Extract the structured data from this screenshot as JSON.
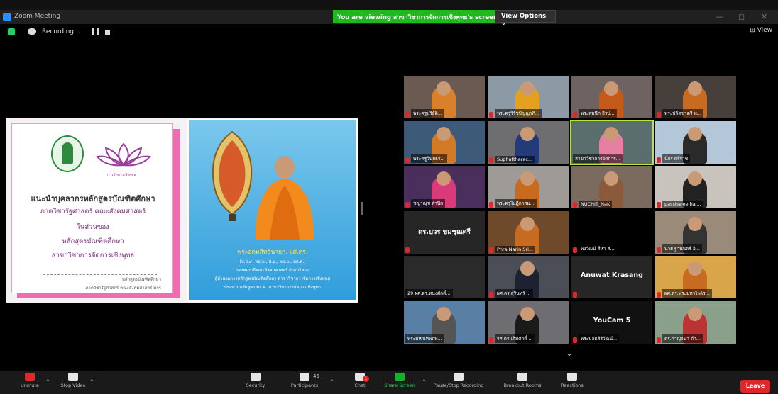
{
  "window": {
    "title": "Zoom Meeting",
    "minimize": "—",
    "maximize": "◻",
    "close": "✕"
  },
  "share_banner": {
    "text": "You are viewing สาขาวิชาการจัดการเชิงพุทธ's screen",
    "view_options": "View Options ⌄"
  },
  "recording": {
    "label": "Recording...",
    "pause": "❚❚"
  },
  "view_button": "⊞ View",
  "shared_slide": {
    "logo_caption": "การจัดการเชิงพุทธ",
    "lines": [
      "แนะนำบุคลากรหลักสูตรบัณฑิตศึกษา",
      "ภาควิชารัฐศาสตร์ คณะสังคมศาสตร์",
      "ในส่วนของ",
      "หลักสูตรบัณฑิตศึกษา",
      "สาขาวิชาการจัดการเชิงพุทธ"
    ],
    "footer": [
      "หลักสูตรบัณฑิตศึกษา",
      "ภาควิชารัฐศาสตร์ คณะสังคมศาสตร์ มจร"
    ],
    "monk_name": "พระอุดมสิทธินายก, ผศ.ดร.",
    "monk_lines": [
      "(ป.ธ.๙, พธ.บ., ป.ม., พธ.ม., พธ.ด.)",
      "รองคณบดีคณะสังคมศาสตร์ ฝ่ายบริหาร",
      "ผู้อำนวยการหลักสูตรบัณฑิตศึกษา สาขาวิชาการจัดการเชิงพุทธ",
      "ประธานหลักสูตร พธ.ด. สาขาวิชาการจัดการเชิงพุทธ"
    ]
  },
  "participants_grid": [
    {
      "name": "พระครูปริยัติ...",
      "bg": "#6a5a52",
      "shirt": "#d9802a",
      "head": "#c99a75",
      "muted": true
    },
    {
      "name": "พระครูวิรัชปัญญาภิ...",
      "bg": "#8b9aa5",
      "shirt": "#e5a020",
      "head": "#c99a75",
      "muted": true
    },
    {
      "name": "พระสมนึก ธีรป...",
      "bg": "#6e6360",
      "shirt": "#c45a1a",
      "head": "#c99a75",
      "muted": true
    },
    {
      "name": "พระปลัดชาตรี พ...",
      "bg": "#473f3c",
      "shirt": "#c86a20",
      "head": "#c99a75",
      "muted": true
    },
    {
      "name": "พระครูวินัยธร...",
      "bg": "#3d5a78",
      "shirt": "#d37a26",
      "head": "#c99a75",
      "muted": true
    },
    {
      "name": "Suphattharac...",
      "bg": "#6e6e70",
      "shirt": "#243b7a",
      "head": "#c99a75",
      "muted": true
    },
    {
      "name": "สาขาวิชาการจัดการ...",
      "bg": "#5b6e6e",
      "shirt": "#e67fa0",
      "head": "#c99a75",
      "muted": false
    },
    {
      "name": "นิกร ศรีราช",
      "bg": "#b3c7d9",
      "shirt": "#2a2a2a",
      "head": "#c99a75",
      "muted": true
    },
    {
      "name": "ชญาณุช สำนึก",
      "bg": "#4a2f5c",
      "shirt": "#d93a7a",
      "head": "#c99a75",
      "muted": true
    },
    {
      "name": "พระครูใบฎีกาสม...",
      "bg": "#9e9a95",
      "shirt": "#c86a20",
      "head": "#c99a75",
      "muted": true
    },
    {
      "name": "NUCHIT_NaK",
      "bg": "#7a6b5e",
      "shirt": "#8a5a3a",
      "head": "#c99a75",
      "muted": true
    },
    {
      "name": "passharee hal...",
      "bg": "#c8c3bc",
      "shirt": "#222",
      "head": "#c99a75",
      "muted": true
    },
    {
      "name": "",
      "bg": "#262626",
      "shirt": "transparent",
      "head": "transparent",
      "muted": true,
      "display": "ดร.บวร ขมชุณศรี"
    },
    {
      "name": "Phra Narin Sri...",
      "bg": "#6e4a2a",
      "shirt": "#c86a20",
      "head": "#c99a75",
      "muted": true
    },
    {
      "name": "พงวัฒน์ สีหา ส...",
      "bg": "#000000",
      "shirt": "transparent",
      "head": "transparent",
      "muted": true
    },
    {
      "name": "นาย ฐานันดร์ อิ...",
      "bg": "#9a8a7a",
      "shirt": "#333",
      "head": "#c99a75",
      "muted": true
    },
    {
      "name": "29 ผศ.ดร.ทนงศักดิ์...",
      "bg": "#2a2a2a",
      "shirt": "transparent",
      "head": "transparent",
      "muted": false
    },
    {
      "name": "ผศ.ดร.สุรินทร์ ...",
      "bg": "#4b4e57",
      "shirt": "#1d2233",
      "head": "#c99a75",
      "muted": true
    },
    {
      "name": "",
      "bg": "#262626",
      "shirt": "transparent",
      "head": "transparent",
      "muted": true,
      "display": "Anuwat Krasang"
    },
    {
      "name": "ผศ.ดร.พระมหาไพโร...",
      "bg": "#d9a54a",
      "shirt": "#c86a20",
      "head": "#c99a75",
      "muted": true
    },
    {
      "name": "พระมหาเทพฤท...",
      "bg": "#5a7fa5",
      "shirt": "#555",
      "head": "#c99a75",
      "muted": false
    },
    {
      "name": "รศ.ดร.เติมศักดิ์ ...",
      "bg": "#6e6e72",
      "shirt": "#1a1a1a",
      "head": "#c99a75",
      "muted": true
    },
    {
      "name": "พระปลัดสิริวัฒน์...",
      "bg": "#111111",
      "shirt": "transparent",
      "head": "transparent",
      "muted": true,
      "display": "YouCam 5"
    },
    {
      "name": "ดร.กาญจนา ดำ...",
      "bg": "#8aa08a",
      "shirt": "#b33",
      "head": "#c99a75",
      "muted": true
    }
  ],
  "toolbar": {
    "unmute": "Unmute",
    "stop_video": "Stop Video",
    "security": "Security",
    "participants": "Participants",
    "participants_count": "45",
    "chat": "Chat",
    "chat_badge": "1",
    "share_screen": "Share Screen",
    "recording": "Pause/Stop Recording",
    "breakout": "Breakout Rooms",
    "reactions": "Reactions",
    "leave": "Leave"
  }
}
